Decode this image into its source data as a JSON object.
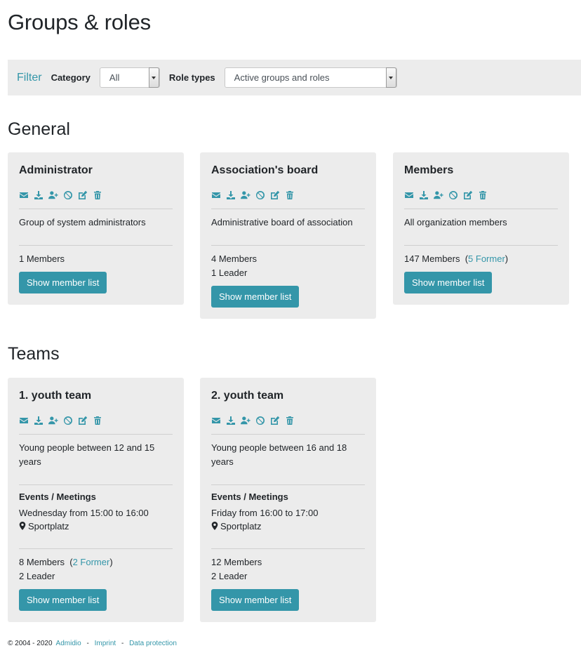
{
  "page": {
    "title": "Groups & roles"
  },
  "filter": {
    "label": "Filter",
    "category_label": "Category",
    "category_value": "All",
    "role_types_label": "Role types",
    "role_types_value": "Active groups and roles"
  },
  "icons": [
    "envelope-icon",
    "download-icon",
    "user-plus-icon",
    "ban-icon",
    "edit-icon",
    "trash-icon"
  ],
  "accent_color": "#3496a9",
  "sections": {
    "general": {
      "title": "General",
      "cards": [
        {
          "title": "Administrator",
          "description": "Group of system administrators",
          "members": "1 Members",
          "former": "",
          "leaders": "",
          "button": "Show member list"
        },
        {
          "title": "Association's board",
          "description": "Administrative board of association",
          "members": "4 Members",
          "former": "",
          "leaders": "1 Leader",
          "button": "Show member list"
        },
        {
          "title": "Members",
          "description": "All organization members",
          "members": "147 Members",
          "former": "5 Former",
          "leaders": "",
          "button": "Show member list"
        }
      ]
    },
    "teams": {
      "title": "Teams",
      "cards": [
        {
          "title": "1. youth team",
          "description": "Young people between 12 and 15 years",
          "events_title": "Events / Meetings",
          "schedule": "Wednesday from 15:00 to 16:00",
          "location": "Sportplatz",
          "members": "8 Members",
          "former": "2 Former",
          "leaders": "2 Leader",
          "button": "Show member list"
        },
        {
          "title": "2. youth team",
          "description": "Young people between 16 and 18 years",
          "events_title": "Events / Meetings",
          "schedule": "Friday from 16:00 to 17:00",
          "location": "Sportplatz",
          "members": "12 Members",
          "former": "",
          "leaders": "2 Leader",
          "button": "Show member list"
        }
      ]
    }
  },
  "footer": {
    "copyright": "© 2004 - 2020",
    "admidio": "Admidio",
    "separator": "-",
    "imprint": "Imprint",
    "data_protection": "Data protection"
  }
}
